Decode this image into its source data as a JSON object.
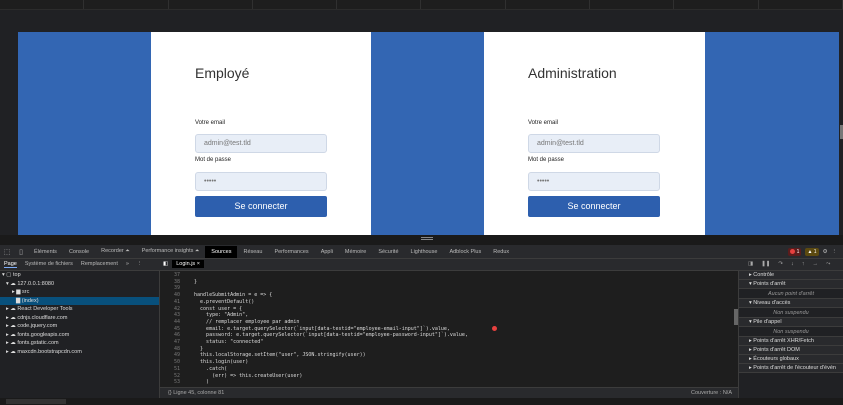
{
  "viewport": {
    "cards": [
      {
        "title": "Employé",
        "email_label": "Votre email",
        "email_value": "admin@test.tld",
        "password_label": "Mot de passe",
        "password_value": "•••••",
        "submit_label": "Se connecter"
      },
      {
        "title": "Administration",
        "email_label": "Votre email",
        "email_value": "admin@test.tld",
        "password_label": "Mot de passe",
        "password_value": "•••••",
        "submit_label": "Se connecter"
      }
    ],
    "brand_blue": "#3366b3"
  },
  "devtools": {
    "tabs": [
      "Éléments",
      "Console",
      "Recorder ⏶",
      "Performance insights ⏶",
      "Sources",
      "Réseau",
      "Performances",
      "Appli",
      "Mémoire",
      "Sécurité",
      "Lighthouse",
      "Adblock Plus",
      "Redux"
    ],
    "active_tab": "Sources",
    "error_count": "1",
    "warning_count": "1",
    "nav_tabs": [
      "Page",
      "Système de fichiers",
      "Remplacement",
      "»"
    ],
    "open_file": "Login.js ×",
    "tree": [
      {
        "label": "▾ ▢ top",
        "indent": 2
      },
      {
        "label": "▾ ☁ 127.0.0.1:8080",
        "indent": 6
      },
      {
        "label": "▸ ▆ src",
        "indent": 12
      },
      {
        "label": "▇ (index)",
        "indent": 16,
        "selected": true
      },
      {
        "label": "▸ ☁ React Developer Tools",
        "indent": 6
      },
      {
        "label": "▸ ☁ cdnjs.cloudflare.com",
        "indent": 6
      },
      {
        "label": "▸ ☁ code.jquery.com",
        "indent": 6
      },
      {
        "label": "▸ ☁ fonts.googleapis.com",
        "indent": 6
      },
      {
        "label": "▸ ☁ fonts.gstatic.com",
        "indent": 6
      },
      {
        "label": "▸ ☁ maxcdn.bootstrapcdn.com",
        "indent": 6
      }
    ],
    "code_lines": [
      {
        "n": "37",
        "t": ""
      },
      {
        "n": "38",
        "t": "  }"
      },
      {
        "n": "39",
        "t": ""
      },
      {
        "n": "40",
        "t": "  handleSubmitAdmin = e => {"
      },
      {
        "n": "41",
        "t": "    e.preventDefault()"
      },
      {
        "n": "42",
        "t": "    const user = {"
      },
      {
        "n": "43",
        "t": "      type: \"Admin\","
      },
      {
        "n": "44",
        "t": "      // remplacer employee par admin"
      },
      {
        "n": "45",
        "t": "      email: e.target.querySelector(`input[data-testid=\"employee-email-input\"]`).value,"
      },
      {
        "n": "46",
        "t": "      password: e.target.querySelector(`input[data-testid=\"employee-password-input\"]`).value,"
      },
      {
        "n": "47",
        "t": "      status: \"connected\""
      },
      {
        "n": "48",
        "t": "    }"
      },
      {
        "n": "49",
        "t": "    this.localStorage.setItem(\"user\", JSON.stringify(user))"
      },
      {
        "n": "50",
        "t": "    this.login(user)"
      },
      {
        "n": "51",
        "t": "      .catch("
      },
      {
        "n": "52",
        "t": "        (err) => this.createUser(user)"
      },
      {
        "n": "53",
        "t": "      )"
      }
    ],
    "status_left": "{}   Ligne 45, colonne 81",
    "status_right": "Couverture : N/A",
    "right_pane": {
      "sections": [
        {
          "label": "▸ Contrôle",
          "sub": null
        },
        {
          "label": "▾ Points d'arrêt",
          "sub": "Aucun point d'arrêt"
        },
        {
          "label": "▾ Niveau d'accès",
          "sub": "Non suspendu"
        },
        {
          "label": "▾ Pile d'appel",
          "sub": "Non suspendu"
        },
        {
          "label": "▸ Points d'arrêt XHR/Fetch",
          "sub": null
        },
        {
          "label": "▸ Points d'arrêt DOM",
          "sub": null
        },
        {
          "label": "▸ Écouteurs globaux",
          "sub": null
        },
        {
          "label": "▸ Points d'arrêt de l'écouteur d'évén",
          "sub": null
        }
      ]
    }
  }
}
